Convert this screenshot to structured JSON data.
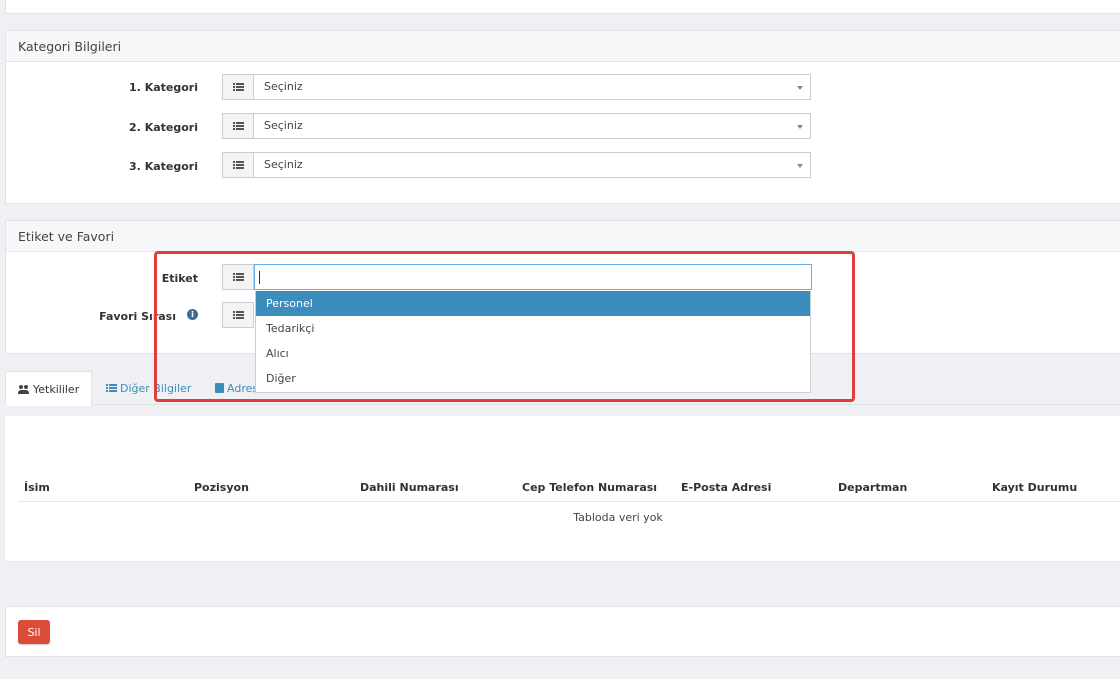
{
  "category_section": {
    "title": "Kategori Bilgileri",
    "rows": [
      {
        "label": "1. Kategori",
        "value": "Seçiniz"
      },
      {
        "label": "2. Kategori",
        "value": "Seçiniz"
      },
      {
        "label": "3. Kategori",
        "value": "Seçiniz"
      }
    ]
  },
  "tag_section": {
    "title": "Etiket ve Favori",
    "tag_label": "Etiket",
    "tag_input_value": "",
    "favorite_label": "Favori Sırası",
    "dropdown_options": [
      "Personel",
      "Tedarikçi",
      "Alıcı",
      "Diğer"
    ],
    "highlight_color": "#e03d3d"
  },
  "tabs": [
    {
      "label": "Yetkililer",
      "icon": "users-icon"
    },
    {
      "label": "Diğer Bilgiler",
      "icon": "list-icon"
    },
    {
      "label": "Adres",
      "icon": "contact-card-icon"
    }
  ],
  "table": {
    "columns": [
      "İsim",
      "Pozisyon",
      "Dahili Numarası",
      "Cep Telefon Numarası",
      "E-Posta Adresi",
      "Departman",
      "Kayıt Durumu"
    ],
    "empty_text": "Tabloda veri yok"
  },
  "footer": {
    "delete_label": "Sil"
  },
  "colors": {
    "accent": "#3c8dbc",
    "danger": "#dd4b39",
    "link": "#3c8dbc"
  }
}
